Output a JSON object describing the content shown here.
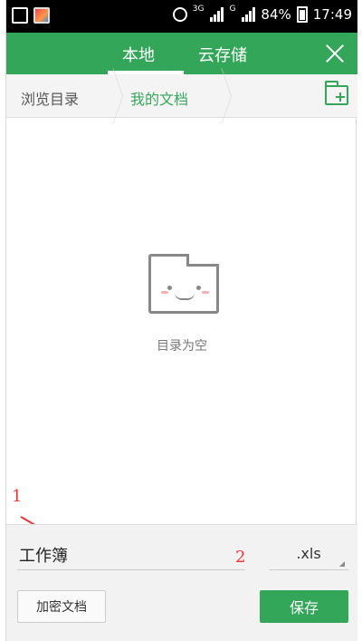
{
  "status_bar": {
    "signal_1_label": "3G",
    "signal_2_label": "G",
    "battery": "84%",
    "time": "17:49"
  },
  "header": {
    "tabs": [
      {
        "label": "本地",
        "active": true
      },
      {
        "label": "云存储",
        "active": false
      }
    ],
    "close_icon": "close-icon"
  },
  "breadcrumb": {
    "root": "浏览目录",
    "current": "我的文档",
    "new_folder_icon": "folder-plus-icon"
  },
  "main": {
    "empty_icon": "empty-folder-icon",
    "empty_text": "目录为空"
  },
  "bottom": {
    "filename_value": "工作簿",
    "extension": ".xls",
    "encrypt_label": "加密文档",
    "save_label": "保存"
  },
  "annotations": {
    "marker_1": "1",
    "marker_2": "2",
    "color": "#e33333"
  },
  "colors": {
    "accent": "#34a65a"
  }
}
